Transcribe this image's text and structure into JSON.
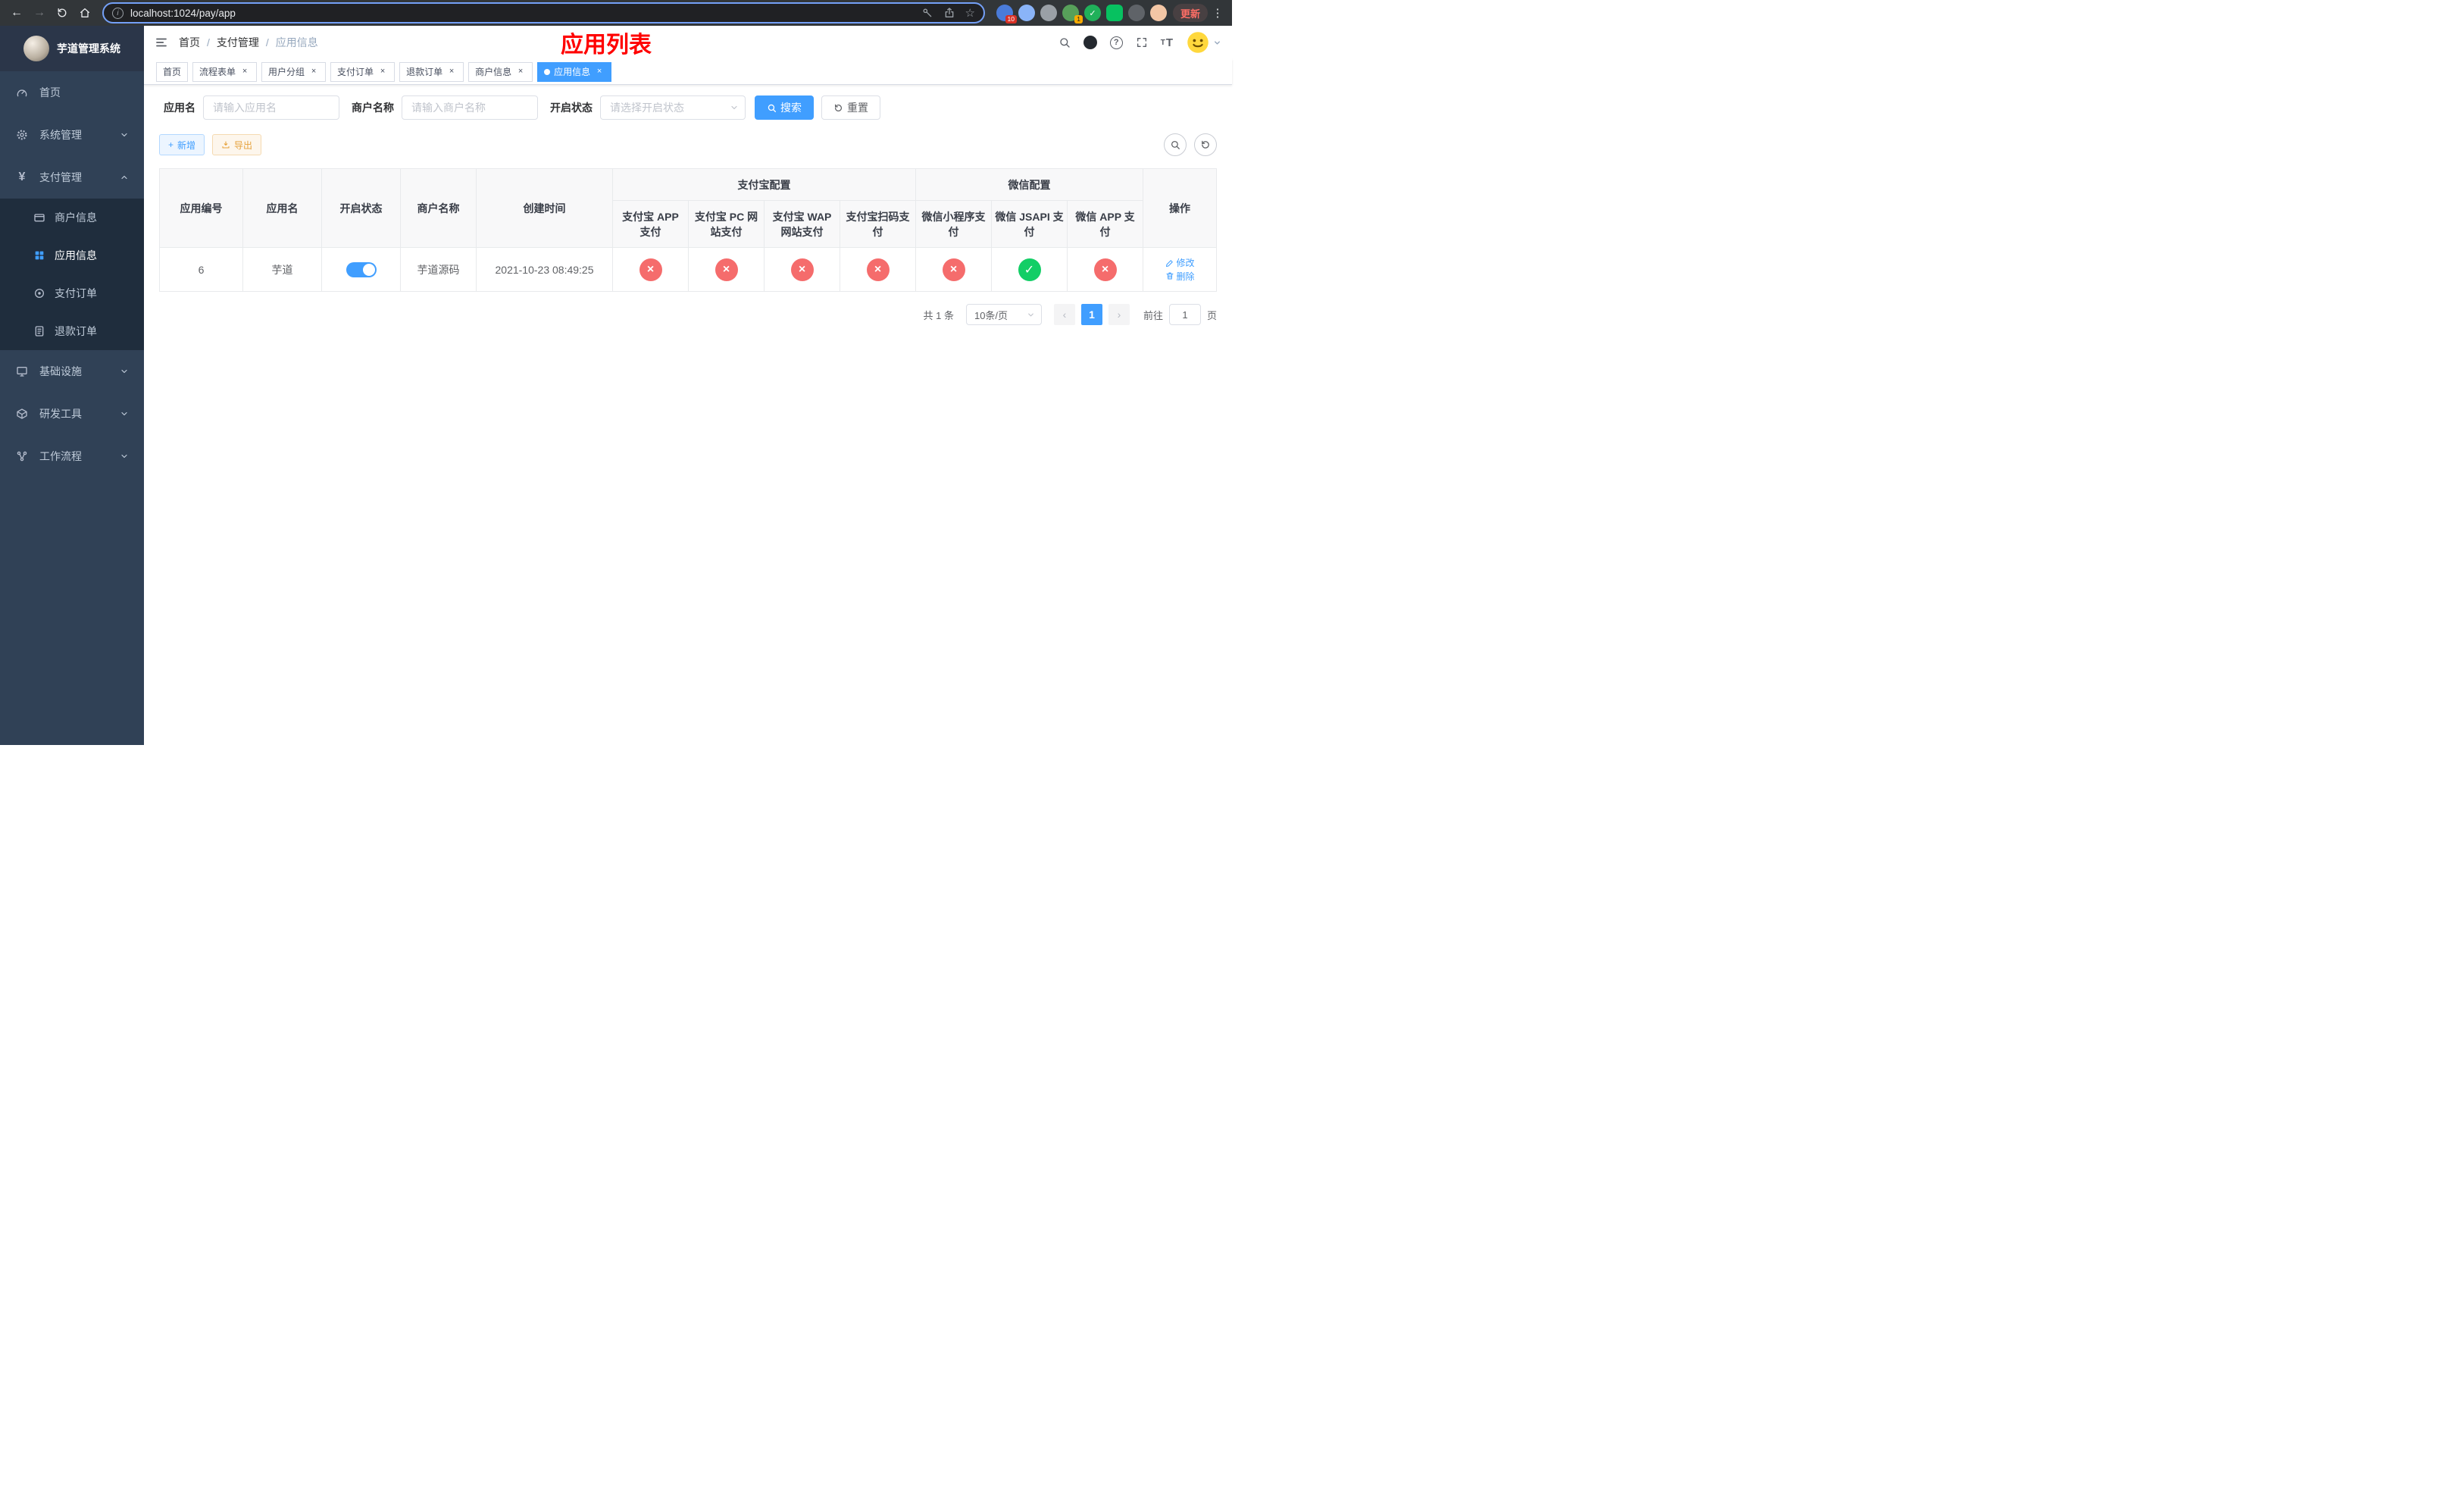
{
  "browser": {
    "url": "localhost:1024/pay/app",
    "update_label": "更新",
    "ext_badge_1": "10",
    "ext_badge_2": "1"
  },
  "icons": {
    "back": "←",
    "forward": "→",
    "star": "☆",
    "kebab": "⋮",
    "info": "i",
    "yen": "¥",
    "plus": "+",
    "close": "×",
    "check": "✓",
    "prev": "‹",
    "next": "›",
    "help": "?",
    "font_small": "T",
    "font_big": "T"
  },
  "sidebar": {
    "title": "芋道管理系统",
    "items": [
      "首页",
      "系统管理",
      "支付管理",
      "基础设施",
      "研发工具",
      "工作流程"
    ],
    "pay_children": [
      "商户信息",
      "应用信息",
      "支付订单",
      "退款订单"
    ]
  },
  "header": {
    "breadcrumb": [
      "首页",
      "支付管理",
      "应用信息"
    ],
    "banner": "应用列表"
  },
  "tabs": [
    "首页",
    "流程表单",
    "用户分组",
    "支付订单",
    "退款订单",
    "商户信息",
    "应用信息"
  ],
  "filters": {
    "app_name_label": "应用名",
    "app_name_placeholder": "请输入应用名",
    "merchant_label": "商户名称",
    "merchant_placeholder": "请输入商户名称",
    "status_label": "开启状态",
    "status_placeholder": "请选择开启状态",
    "search_label": "搜索",
    "reset_label": "重置"
  },
  "toolbar": {
    "add_label": "新增",
    "export_label": "导出"
  },
  "table": {
    "simple_columns": [
      "应用编号",
      "应用名",
      "开启状态",
      "商户名称",
      "创建时间"
    ],
    "alipay_group": "支付宝配置",
    "wechat_group": "微信配置",
    "pay_columns": [
      "支付宝 APP 支付",
      "支付宝 PC 网站支付",
      "支付宝 WAP 网站支付",
      "支付宝扫码支付",
      "微信小程序支付",
      "微信 JSAPI 支付",
      "微信 APP 支付"
    ],
    "action_column": "操作",
    "row": {
      "id": "6",
      "name": "芋道",
      "enabled": true,
      "merchant": "芋道源码",
      "created": "2021-10-23 08:49:25",
      "statuses": [
        "fail",
        "fail",
        "fail",
        "fail",
        "fail",
        "success",
        "fail"
      ],
      "edit_label": "修改",
      "delete_label": "删除"
    }
  },
  "pagination": {
    "total": "共 1 条",
    "page_size": "10条/页",
    "current_page": "1",
    "goto_label": "前往",
    "goto_value": "1",
    "page_label": "页"
  }
}
